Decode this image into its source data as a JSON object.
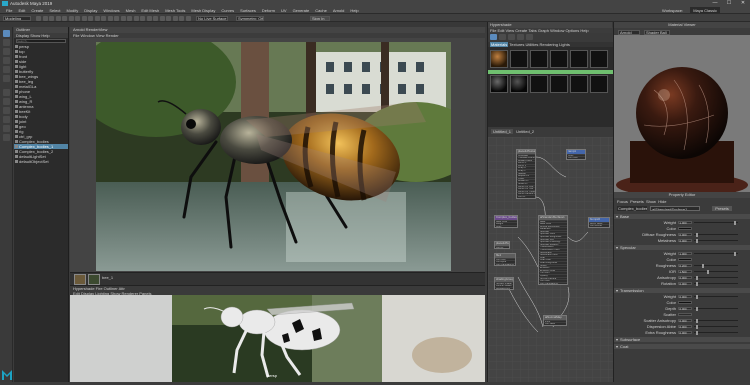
{
  "app": {
    "title": "Autodesk Maya 2019",
    "window_controls": [
      "—",
      "☐",
      "✕"
    ]
  },
  "menubar": {
    "items": [
      "File",
      "Edit",
      "Create",
      "Select",
      "Modify",
      "Display",
      "Windows",
      "Mesh",
      "Edit Mesh",
      "Mesh Tools",
      "Mesh Display",
      "Curves",
      "Surfaces",
      "Deform",
      "UV",
      "Generate",
      "Cache",
      "Arnold",
      "Help"
    ],
    "workspace_label": "Workspace:",
    "workspace_value": "Maya Classic"
  },
  "statusline": {
    "mode": "Modeling",
    "field": "No Live Surface",
    "symmetry": "Symmetry: Off",
    "sign_in": "Sign In"
  },
  "outliner": {
    "title": "Outliner",
    "menu": "Display  Show  Help",
    "search_placeholder": "Search...",
    "items": [
      "persp",
      "top",
      "front",
      "side",
      "light",
      "butterfly",
      "bee_wings",
      "bee_leg",
      "metalGLa",
      "phone",
      "wing_L",
      "wing_R",
      "antenna",
      "beeKit",
      "body",
      "joint",
      "geo",
      "rig",
      "ctrl_grp",
      "Complex_bodies",
      "Complex_bodies_1",
      "Complex_bodies_2",
      "defaultLightSet",
      "defaultObjectSet"
    ],
    "selected_index": 20
  },
  "viewport": {
    "title": "Arnold RenderView",
    "menu": "File  Window  View  Render",
    "thumb_label": "bee_1"
  },
  "timeline": {
    "label": "Hypershade  Fire  Outliner  Attr",
    "row": "Edit  Display  Lighting  Show  Renderer  Panels"
  },
  "bottom": {
    "caption": "persp"
  },
  "hypershade": {
    "title": "Hypershade",
    "menu": "File  Edit  View  Create  Tabs  Graph  Window  Options  Help",
    "browser_tabs": [
      "Materials",
      "Textures",
      "Utilities",
      "Rendering",
      "Lights",
      "Cameras",
      "Shading Groups",
      "Bake Sets",
      "Projects"
    ],
    "graph_tabs": [
      "Untitled_1",
      "Untitled_2"
    ]
  },
  "nodes": [
    {
      "title": "place2dTexture",
      "ports": [
        "Coverage",
        "Translate Frame",
        "Rotate Frame",
        "Mirror U",
        "Mirror V",
        "Wrap U",
        "Wrap V",
        "Stagger",
        "Repeat UV",
        "Offset",
        "Rotate UV",
        "Noise UV",
        "Vertex UV One",
        "Vertex UV Two",
        "Vertex UV Three",
        "Vertex Camera One",
        "Out UV"
      ]
    },
    {
      "title": "ramp1",
      "ports": [
        "Color",
        "Out Color"
      ]
    },
    {
      "title": "Complex_bodies_1Shape",
      "ports": [
        "Base Color",
        "Weight",
        "Color"
      ]
    },
    {
      "title": "aiStandardSurface1",
      "ports": [
        "Base",
        "Base Color",
        "Diffuse Roughness",
        "Metalness",
        "Specular",
        "Specular Color",
        "Specular Roughness",
        "Specular IOR",
        "Specular Anisotropy",
        "Specular Rotation",
        "Transmission",
        "Transmission Color",
        "Subsurface",
        "Subsurface Color",
        "Coat",
        "Coat Color",
        "Coat Roughness",
        "Sheen",
        "Emission",
        "Emission Color",
        "Thin Film",
        "Opacity",
        "Normal Camera",
        "Out Color",
        "Out Transparency"
      ]
    },
    {
      "title": "bump2d",
      "ports": [
        "Bump Value",
        "Out Normal"
      ]
    },
    {
      "title": "file1",
      "ports": [
        "Out Color",
        "Out Alpha",
        "Out Transparency"
      ]
    },
    {
      "title": "shadingGroup",
      "ports": [
        "Surface Shader",
        "Volume Shader",
        "Displacement"
      ]
    },
    {
      "title": "aiNormalMap",
      "ports": [
        "Input",
        "Out Value"
      ]
    },
    {
      "title": "place2dTexture2",
      "ports": [
        "Out UV"
      ]
    }
  ],
  "material_viewer": {
    "title": "Material Viewer",
    "renderer": "Arnold",
    "shape": "Shader Ball"
  },
  "property_editor": {
    "title": "Property Editor",
    "node_name": "Complex_bodies_1Shape",
    "node_field": "aiStandardSurface1",
    "preset_button": "Presets",
    "links": [
      "Focus",
      "Presets",
      "Show",
      "Hide"
    ],
    "sections": [
      {
        "name": "Base",
        "rows": [
          {
            "label": "Weight",
            "value": "1.000",
            "pos": 0.95
          },
          {
            "label": "Color",
            "value": "",
            "pos": 0.0
          },
          {
            "label": "Diffuse Roughness",
            "value": "0.000",
            "pos": 0.05
          },
          {
            "label": "Metalness",
            "value": "0.000",
            "pos": 0.05
          }
        ]
      },
      {
        "name": "Specular",
        "rows": [
          {
            "label": "Weight",
            "value": "1.000",
            "pos": 0.95
          },
          {
            "label": "Color",
            "value": "",
            "pos": 0.0
          },
          {
            "label": "Roughness",
            "value": "0.200",
            "pos": 0.2
          },
          {
            "label": "IOR",
            "value": "1.500",
            "pos": 0.3
          },
          {
            "label": "Anisotropy",
            "value": "0.000",
            "pos": 0.05
          },
          {
            "label": "Rotation",
            "value": "0.000",
            "pos": 0.05
          }
        ]
      },
      {
        "name": "Transmission",
        "rows": [
          {
            "label": "Weight",
            "value": "0.000",
            "pos": 0.05
          },
          {
            "label": "Color",
            "value": "",
            "pos": 0.0
          },
          {
            "label": "Depth",
            "value": "0.000",
            "pos": 0.05
          },
          {
            "label": "Scatter",
            "value": "",
            "pos": 0.0
          },
          {
            "label": "Scatter Anisotropy",
            "value": "0.000",
            "pos": 0.05
          },
          {
            "label": "Dispersion Abbe",
            "value": "0.000",
            "pos": 0.05
          },
          {
            "label": "Extra Roughness",
            "value": "0.000",
            "pos": 0.05
          }
        ]
      },
      {
        "name": "Subsurface",
        "rows": []
      },
      {
        "name": "Coat",
        "rows": []
      }
    ]
  },
  "colors": {
    "accent": "#5285a6",
    "panel": "#3c3c3c",
    "dark": "#2b2b2b",
    "node_header": "#5d5d5d",
    "blue_node": "#4466aa",
    "purple_node": "#6a4a8a"
  }
}
